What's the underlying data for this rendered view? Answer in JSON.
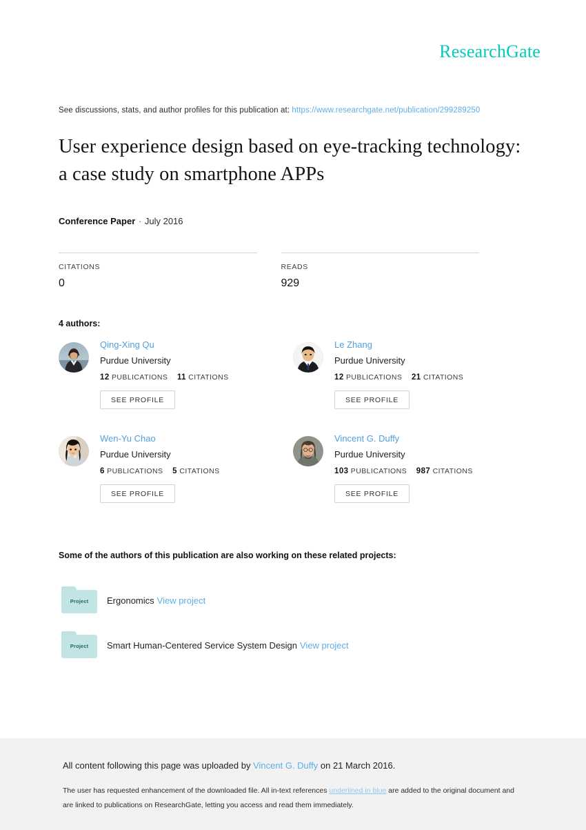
{
  "brand": {
    "logo_text": "ResearchGate",
    "logo_color": "#00ccb8"
  },
  "discussion": {
    "prefix": "See discussions, stats, and author profiles for this publication at:",
    "url": "https://www.researchgate.net/publication/299289250",
    "url_color": "#5eaee8"
  },
  "publication": {
    "title": "User experience design based on eye-tracking technology: a case study on smartphone APPs",
    "type": "Conference Paper",
    "separator": "·",
    "date": "July 2016"
  },
  "stats": [
    {
      "label": "CITATIONS",
      "value": "0"
    },
    {
      "label": "READS",
      "value": "929"
    }
  ],
  "authors_section": {
    "heading": "4 authors:",
    "see_profile_label": "SEE PROFILE",
    "publications_label": "PUBLICATIONS",
    "citations_label": "CITATIONS",
    "name_color": "#4f9fe0"
  },
  "authors": [
    {
      "name": "Qing-Xing Qu",
      "affiliation": "Purdue University",
      "publications": "12",
      "citations": "11",
      "avatar_name": "avatar-qing-xing-qu"
    },
    {
      "name": "Le Zhang",
      "affiliation": "Purdue University",
      "publications": "12",
      "citations": "21",
      "avatar_name": "avatar-le-zhang"
    },
    {
      "name": "Wen-Yu Chao",
      "affiliation": "Purdue University",
      "publications": "6",
      "citations": "5",
      "avatar_name": "avatar-wen-yu-chao"
    },
    {
      "name": "Vincent G. Duffy",
      "affiliation": "Purdue University",
      "publications": "103",
      "citations": "987",
      "avatar_name": "avatar-vincent-g-duffy"
    }
  ],
  "projects_section": {
    "heading": "Some of the authors of this publication are also working on these related projects:",
    "folder_label": "Project",
    "view_project_label": "View project"
  },
  "projects": [
    {
      "title": "Ergonomics"
    },
    {
      "title": "Smart Human-Centered Service System Design"
    }
  ],
  "footer": {
    "main_prefix": "All content following this page was uploaded by",
    "uploader": "Vincent G. Duffy",
    "main_suffix": "on 21 March 2016.",
    "note_part1": "The user has requested enhancement of the downloaded file. All in-text references",
    "note_highlight": "underlined in blue",
    "note_part2": "are added to the original document",
    "note_line2": "and are linked to publications on ResearchGate, letting you access and read them immediately."
  }
}
